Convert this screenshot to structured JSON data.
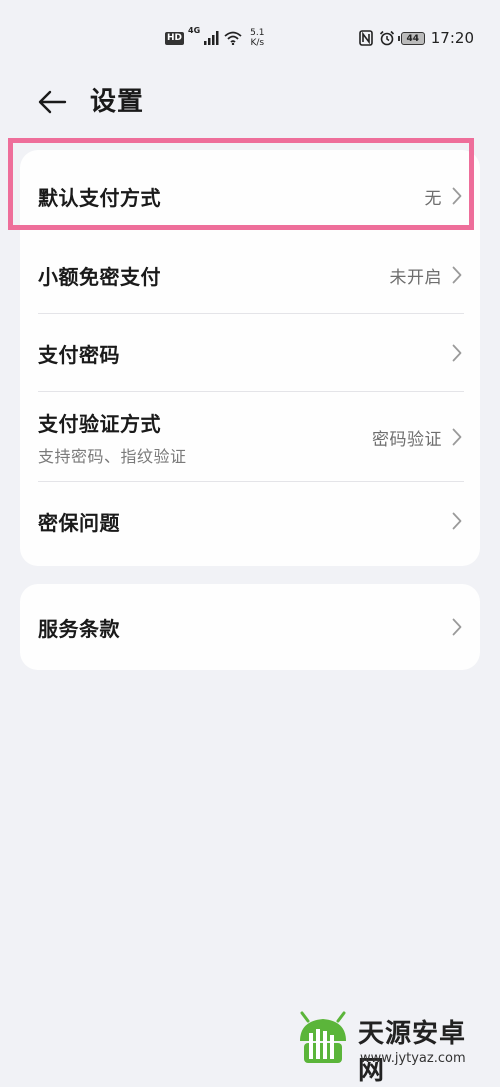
{
  "status_bar": {
    "hd": "HD",
    "network": "4G",
    "speed_value": "5.1",
    "speed_unit": "K/s",
    "battery": "44",
    "time": "17:20"
  },
  "header": {
    "title": "设置"
  },
  "settings": {
    "items": [
      {
        "label": "默认支付方式",
        "value": "无"
      },
      {
        "label": "小额免密支付",
        "value": "未开启"
      },
      {
        "label": "支付密码",
        "value": ""
      },
      {
        "label": "支付验证方式",
        "sub": "支持密码、指纹验证",
        "value": "密码验证"
      },
      {
        "label": "密保问题",
        "value": ""
      }
    ],
    "other": [
      {
        "label": "服务条款",
        "value": ""
      }
    ]
  },
  "watermark": {
    "name": "天源安卓网",
    "url": "www.jytyaz.com"
  },
  "colors": {
    "background": "#f1f2f6",
    "card": "#fefefe",
    "highlight": "#ee6e9a",
    "watermark_green": "#5bb53a"
  }
}
